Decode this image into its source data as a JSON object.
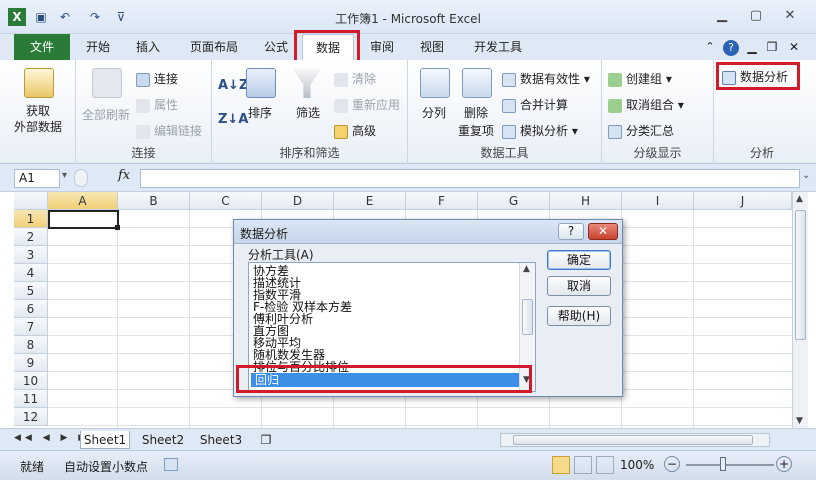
{
  "window": {
    "title": "工作簿1 - Microsoft Excel"
  },
  "tabs": [
    "文件",
    "开始",
    "插入",
    "页面布局",
    "公式",
    "数据",
    "审阅",
    "视图",
    "开发工具"
  ],
  "ribbon": {
    "get_external": [
      "获取",
      "外部数据"
    ],
    "refresh_all": "全部刷新",
    "connections": [
      "连接",
      "属性",
      "编辑链接"
    ],
    "group_connections": "连接",
    "sort": "排序",
    "filter": "筛选",
    "sort_filter_small": [
      "清除",
      "重新应用",
      "高级"
    ],
    "group_sort": "排序和筛选",
    "split": "分列",
    "remove_dup": [
      "删除",
      "重复项"
    ],
    "data_tools_small": [
      "数据有效性",
      "合并计算",
      "模拟分析"
    ],
    "group_data_tools": "数据工具",
    "outline_small": [
      "创建组",
      "取消组合",
      "分类汇总"
    ],
    "group_outline": "分级显示",
    "data_analysis": "数据分析",
    "group_analysis": "分析"
  },
  "formula_bar": {
    "name_box": "A1",
    "fx": "fx"
  },
  "grid": {
    "columns": [
      "A",
      "B",
      "C",
      "D",
      "E",
      "F",
      "G",
      "H",
      "I",
      "J"
    ],
    "rows": [
      "1",
      "2",
      "3",
      "4",
      "5",
      "6",
      "7",
      "8",
      "9",
      "10",
      "11",
      "12"
    ]
  },
  "dialog": {
    "title": "数据分析",
    "list_label": "分析工具(A)",
    "items": [
      "协方差",
      "描述统计",
      "指数平滑",
      "F-检验 双样本方差",
      "傅利叶分析",
      "直方图",
      "移动平均",
      "随机数发生器",
      "排位与百分比排位",
      "回归"
    ],
    "selected": "回归",
    "buttons": {
      "ok": "确定",
      "cancel": "取消",
      "help": "帮助(H)"
    },
    "help_icon": "?",
    "close_icon": "✕"
  },
  "sheets": [
    "Sheet1",
    "Sheet2",
    "Sheet3"
  ],
  "status": {
    "ready": "就绪",
    "auto_decimal": "自动设置小数点",
    "zoom": "100%"
  },
  "colors": {
    "highlight_red": "#d11a2a",
    "file_tab": "#2a7b38",
    "selection_blue": "#3d8ee6"
  }
}
